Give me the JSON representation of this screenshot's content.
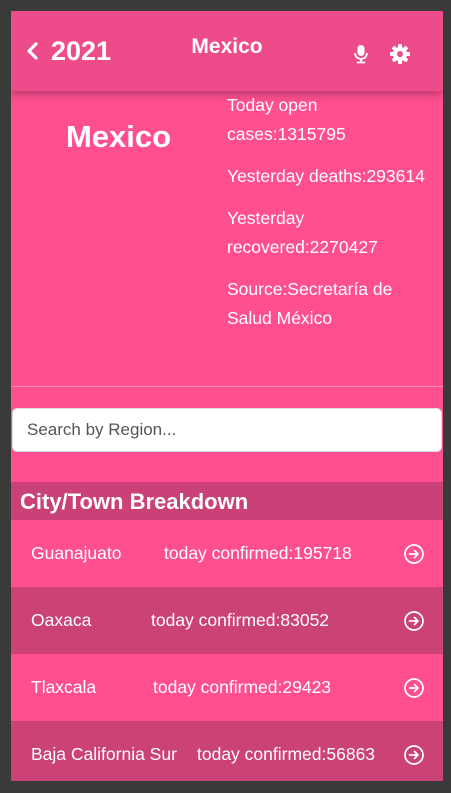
{
  "header": {
    "back_label": "2021",
    "title": "Mexico",
    "icons": {
      "back": "chevron-left-icon",
      "mic": "microphone-icon",
      "settings": "gear-icon"
    }
  },
  "summary": {
    "country": "Mexico",
    "today_open_cases": "Today open cases:1315795",
    "yesterday_deaths": "Yesterday deaths:293614",
    "yesterday_recovered": "Yesterday recovered:2270427",
    "source": "Source:Secretaría de Salud México"
  },
  "search": {
    "placeholder": "Search by Region..."
  },
  "breakdown": {
    "title": "City/Town Breakdown",
    "rows": [
      {
        "region": "Guanajuato",
        "confirmed": "today confirmed:195718"
      },
      {
        "region": "Oaxaca",
        "confirmed": "today confirmed:83052"
      },
      {
        "region": "Tlaxcala",
        "confirmed": "today confirmed:29423"
      },
      {
        "region": "Baja California Sur",
        "confirmed": "today confirmed:56863"
      }
    ]
  },
  "colors": {
    "primary": "#ff4f91",
    "header": "#ee4b8a",
    "alt_row": "#cb4276",
    "section": "#c94176"
  }
}
